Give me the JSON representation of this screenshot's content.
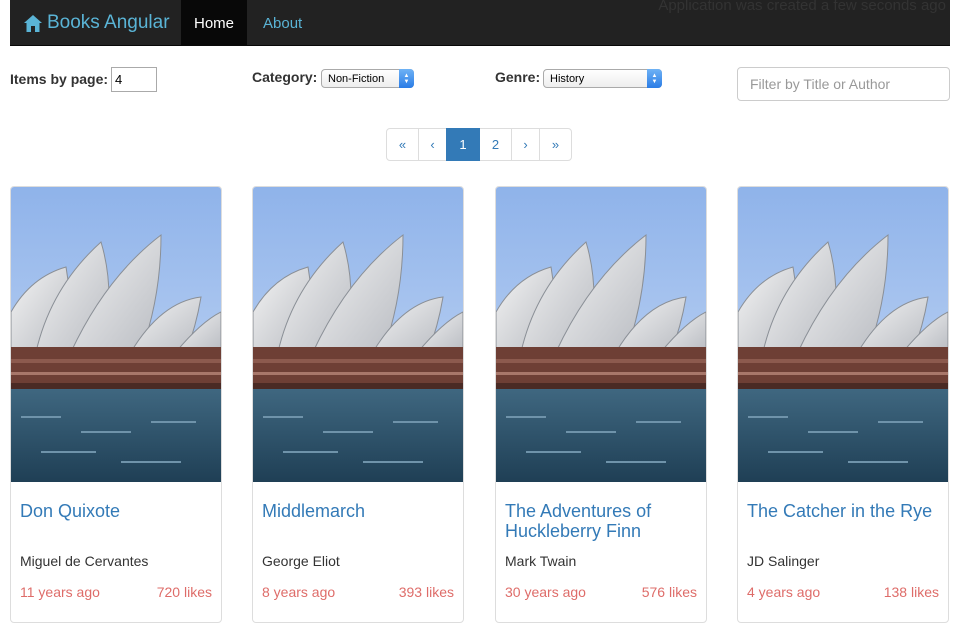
{
  "navbar": {
    "brand": "Books Angular",
    "home": "Home",
    "about": "About",
    "status": "Application was created a few seconds ago"
  },
  "filters": {
    "items_label": "Items by page:",
    "items_value": "4",
    "category_label": "Category:",
    "category_value": "Non-Fiction",
    "genre_label": "Genre:",
    "genre_value": "History",
    "search_placeholder": "Filter by Title or Author"
  },
  "pagination": {
    "first": "«",
    "prev": "‹",
    "pages": [
      "1",
      "2"
    ],
    "active_page": "1",
    "next": "›",
    "last": "»"
  },
  "books": [
    {
      "title": "Don Quixote",
      "author": "Miguel de Cervantes",
      "age": "11 years ago",
      "likes": "720 likes"
    },
    {
      "title": "Middlemarch",
      "author": "George Eliot",
      "age": "8 years ago",
      "likes": "393 likes"
    },
    {
      "title": "The Adventures of Huckleberry Finn",
      "author": "Mark Twain",
      "age": "30 years ago",
      "likes": "576 likes"
    },
    {
      "title": "The Catcher in the Rye",
      "author": "JD Salinger",
      "age": "4 years ago",
      "likes": "138 likes"
    }
  ],
  "colors": {
    "link": "#337ab7",
    "accent_red": "#d9534f",
    "navbar_bg": "#222222",
    "brand": "#5ab4d6"
  }
}
